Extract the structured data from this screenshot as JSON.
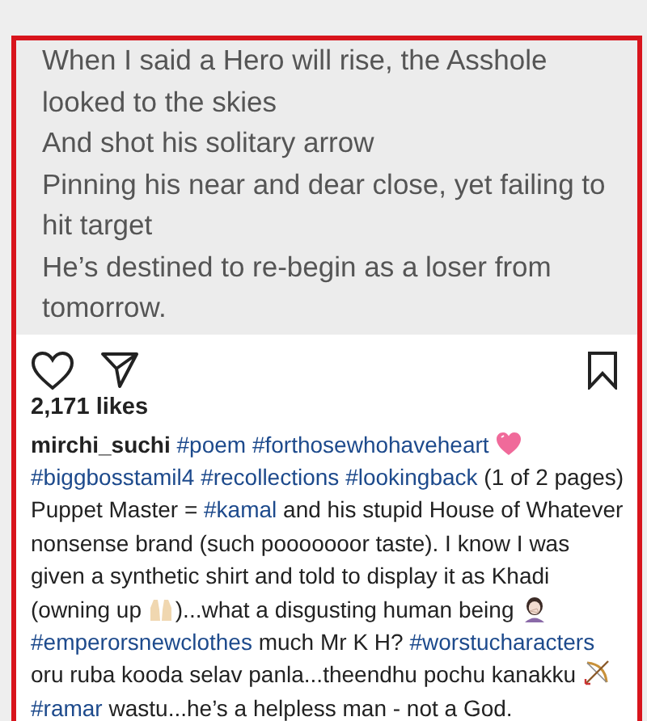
{
  "post_image": {
    "lines": [
      "When I said a Hero will rise, the Asshole looked to the skies",
      "And shot his solitary arrow",
      "Pinning his near and dear close, yet failing to hit target",
      "He’s destined to re-begin as a loser from tomorrow."
    ]
  },
  "actions": {
    "liked": false,
    "saved": false
  },
  "likes": "2,171 likes",
  "caption": [
    {
      "kind": "user",
      "text": "mirchi_suchi"
    },
    {
      "kind": "tag",
      "text": "#poem"
    },
    {
      "kind": "tag",
      "text": "#forthosewhohaveheart"
    },
    {
      "kind": "heart"
    },
    {
      "kind": "tag",
      "text": "#biggbosstamil4"
    },
    {
      "kind": "tag",
      "text": "#recollections"
    },
    {
      "kind": "tag",
      "text": "#lookingback"
    },
    {
      "kind": "text",
      "text": " (1 of 2 pages) Puppet Master = "
    },
    {
      "kind": "tag",
      "text": "#kamal"
    },
    {
      "kind": "text",
      "text": " and his stupid House of Whatever nonsense brand (such pooooooor taste). I know I was given a synthetic shirt and told to display it as Khadi (owning up "
    },
    {
      "kind": "hands"
    },
    {
      "kind": "text",
      "text": ")...what a disgusting human being "
    },
    {
      "kind": "facepalm"
    },
    {
      "kind": "tag",
      "text": "#emperorsnewclothes"
    },
    {
      "kind": "text",
      "text": " much Mr K H? "
    },
    {
      "kind": "tag",
      "text": "#worstucharacters"
    },
    {
      "kind": "text",
      "text": " oru ruba kooda selav panla...theendhu pochu kanakku "
    },
    {
      "kind": "bow"
    },
    {
      "kind": "tag",
      "text": "#ramar"
    },
    {
      "kind": "text",
      "text": " wastu...he’s a helpless man - not a God."
    }
  ]
}
